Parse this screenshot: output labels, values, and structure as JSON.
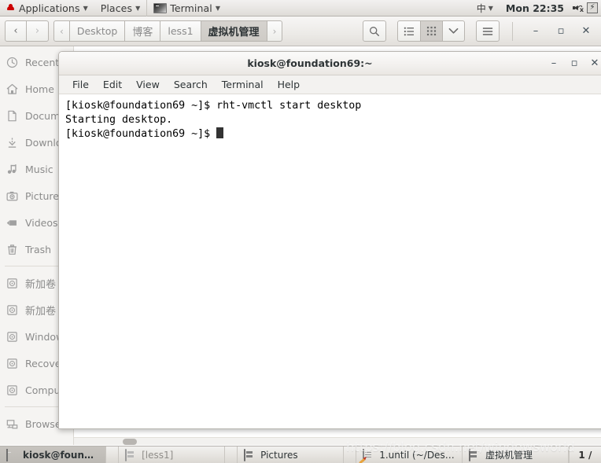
{
  "top_panel": {
    "applications_label": "Applications",
    "places_label": "Places",
    "window_indicator_label": "Terminal",
    "input_method": "中",
    "clock": "Mon 22:35",
    "speaker_state": "muted",
    "power_icon": "power-bolt"
  },
  "file_manager": {
    "nav": {
      "back_label": "‹",
      "forward_label": "›"
    },
    "breadcrumb_prev": "‹",
    "breadcrumb_next": "›",
    "breadcrumbs": [
      {
        "label": "Desktop",
        "selected": false,
        "cjk": false
      },
      {
        "label": "博客",
        "selected": false,
        "cjk": true
      },
      {
        "label": "less1",
        "selected": false,
        "cjk": false
      },
      {
        "label": "虚拟机管理",
        "selected": true,
        "cjk": true
      }
    ],
    "toolbar": {
      "search_icon": "search-icon",
      "list_view_icon": "list-view-icon",
      "grid_view_icon": "grid-view-icon",
      "view_dropdown_icon": "chevron-down-icon",
      "menu_icon": "hamburger-menu-icon",
      "active_view": "grid"
    },
    "window_buttons": {
      "minimize": "–",
      "maximize": "▫",
      "close": "✕"
    },
    "sidebar": [
      {
        "label": "Recent",
        "icon": "clock-icon",
        "cjk": false
      },
      {
        "label": "Home",
        "icon": "home-icon",
        "cjk": false
      },
      {
        "label": "Documents",
        "icon": "document-icon",
        "cjk": false
      },
      {
        "label": "Downloads",
        "icon": "download-icon",
        "cjk": false
      },
      {
        "label": "Music",
        "icon": "music-icon",
        "cjk": false
      },
      {
        "label": "Pictures",
        "icon": "camera-icon",
        "cjk": false
      },
      {
        "label": "Videos",
        "icon": "video-icon",
        "cjk": false
      },
      {
        "label": "Trash",
        "icon": "trash-icon",
        "cjk": false
      }
    ],
    "sidebar_devices": [
      {
        "label": "新加卷",
        "icon": "drive-icon",
        "cjk": true
      },
      {
        "label": "新加卷",
        "icon": "drive-icon",
        "cjk": true
      },
      {
        "label": "Windows",
        "icon": "drive-icon",
        "cjk": false
      },
      {
        "label": "Recovery",
        "icon": "drive-icon",
        "cjk": false
      },
      {
        "label": "Computer",
        "icon": "drive-icon",
        "cjk": false
      }
    ],
    "sidebar_network": [
      {
        "label": "Browse Network",
        "icon": "network-icon",
        "cjk": false
      }
    ]
  },
  "terminal": {
    "title": "kiosk@foundation69:~",
    "menu": [
      "File",
      "Edit",
      "View",
      "Search",
      "Terminal",
      "Help"
    ],
    "window_buttons": {
      "minimize": "–",
      "maximize": "▫",
      "close": "✕"
    },
    "lines": [
      "[kiosk@foundation69 ~]$ rht-vmctl start desktop",
      "Starting desktop.",
      "[kiosk@foundation69 ~]$ "
    ]
  },
  "taskbar": {
    "items": [
      {
        "label": "kiosk@foundat...",
        "icon": "terminal-icon",
        "active": true,
        "dim": false
      },
      {
        "label": "[less1]",
        "icon": "file-manager-icon",
        "active": false,
        "dim": true
      },
      {
        "label": "Pictures",
        "icon": "file-manager-icon",
        "active": false,
        "dim": false
      },
      {
        "label": "1.until (~/Desk...",
        "icon": "text-editor-icon",
        "active": false,
        "dim": false
      },
      {
        "label": "虚拟机管理",
        "icon": "file-manager-icon",
        "active": false,
        "dim": false
      }
    ],
    "workspace": "1 /"
  },
  "watermark": "https://blog.csdn.net/windowsworld"
}
